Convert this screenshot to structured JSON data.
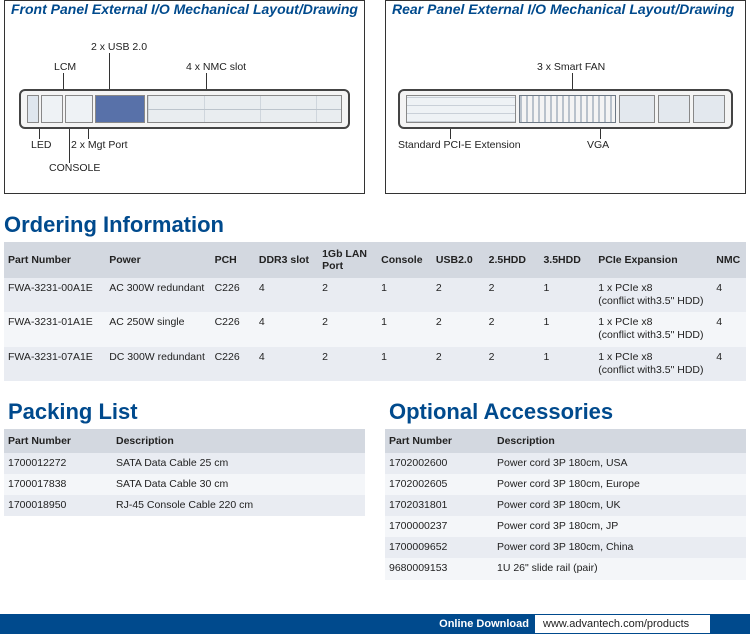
{
  "panels": {
    "front": {
      "title": "Front Panel External I/O Mechanical Layout/Drawing",
      "labels": {
        "usb": "2 x USB 2.0",
        "lcm": "LCM",
        "nmc": "4 x NMC slot",
        "led": "LED",
        "mgt": "2 x Mgt Port",
        "console": "CONSOLE"
      }
    },
    "rear": {
      "title": "Rear Panel External I/O Mechanical Layout/Drawing",
      "labels": {
        "fan": "3 x Smart FAN",
        "pci": "Standard PCI-E Extension",
        "vga": "VGA"
      }
    }
  },
  "ordering": {
    "heading": "Ordering Information",
    "columns": [
      "Part Number",
      "Power",
      "PCH",
      "DDR3 slot",
      "1Gb LAN Port",
      "Console",
      "USB2.0",
      "2.5HDD",
      "3.5HDD",
      "PCIe Expansion",
      "NMC"
    ],
    "rows": [
      {
        "cells": [
          "FWA-3231-00A1E",
          "AC 300W redundant",
          "C226",
          "4",
          "2",
          "1",
          "2",
          "2",
          "1",
          "1 x PCIe x8\n(conflict with3.5\" HDD)",
          "4"
        ]
      },
      {
        "cells": [
          "FWA-3231-01A1E",
          "AC 250W single",
          "C226",
          "4",
          "2",
          "1",
          "2",
          "2",
          "1",
          "1 x PCIe x8\n(conflict with3.5\" HDD)",
          "4"
        ]
      },
      {
        "cells": [
          "FWA-3231-07A1E",
          "DC 300W redundant",
          "C226",
          "4",
          "2",
          "1",
          "2",
          "2",
          "1",
          "1 x PCIe x8\n(conflict with3.5\" HDD)",
          "4"
        ]
      }
    ]
  },
  "packing": {
    "heading": "Packing List",
    "columns": [
      "Part Number",
      "Description"
    ],
    "rows": [
      {
        "cells": [
          "1700012272",
          "SATA Data Cable 25 cm"
        ]
      },
      {
        "cells": [
          "1700017838",
          "SATA Data Cable 30 cm"
        ]
      },
      {
        "cells": [
          "1700018950",
          "RJ-45 Console Cable 220 cm"
        ]
      }
    ]
  },
  "accessories": {
    "heading": "Optional Accessories",
    "columns": [
      "Part Number",
      "Description"
    ],
    "rows": [
      {
        "cells": [
          "1702002600",
          "Power cord 3P 180cm, USA"
        ]
      },
      {
        "cells": [
          "1702002605",
          "Power cord 3P 180cm, Europe"
        ]
      },
      {
        "cells": [
          "1702031801",
          "Power cord 3P 180cm, UK"
        ]
      },
      {
        "cells": [
          "1700000237",
          "Power cord 3P 180cm, JP"
        ]
      },
      {
        "cells": [
          "1700009652",
          "Power cord 3P 180cm, China"
        ]
      },
      {
        "cells": [
          "9680009153",
          "1U 26\" slide rail (pair)"
        ]
      }
    ]
  },
  "download": {
    "label": "Online Download",
    "url": "www.advantech.com/products"
  }
}
